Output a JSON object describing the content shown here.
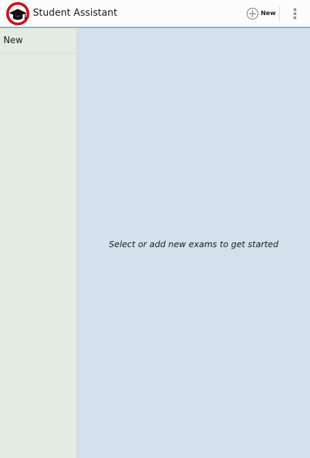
{
  "app": {
    "title": "Student Assistant",
    "logo_icon": "graduation-cap-icon"
  },
  "action_bar": {
    "new_label": "New",
    "new_icon": "add-circle-icon",
    "overflow_icon": "overflow-menu-icon",
    "accent_color": "#6fb4dc"
  },
  "sidebar": {
    "items": [
      {
        "label": "New"
      }
    ],
    "background": "#e3ebe2"
  },
  "content": {
    "empty_message": "Select or add new exams to get started",
    "background": "#d4e1ec"
  }
}
